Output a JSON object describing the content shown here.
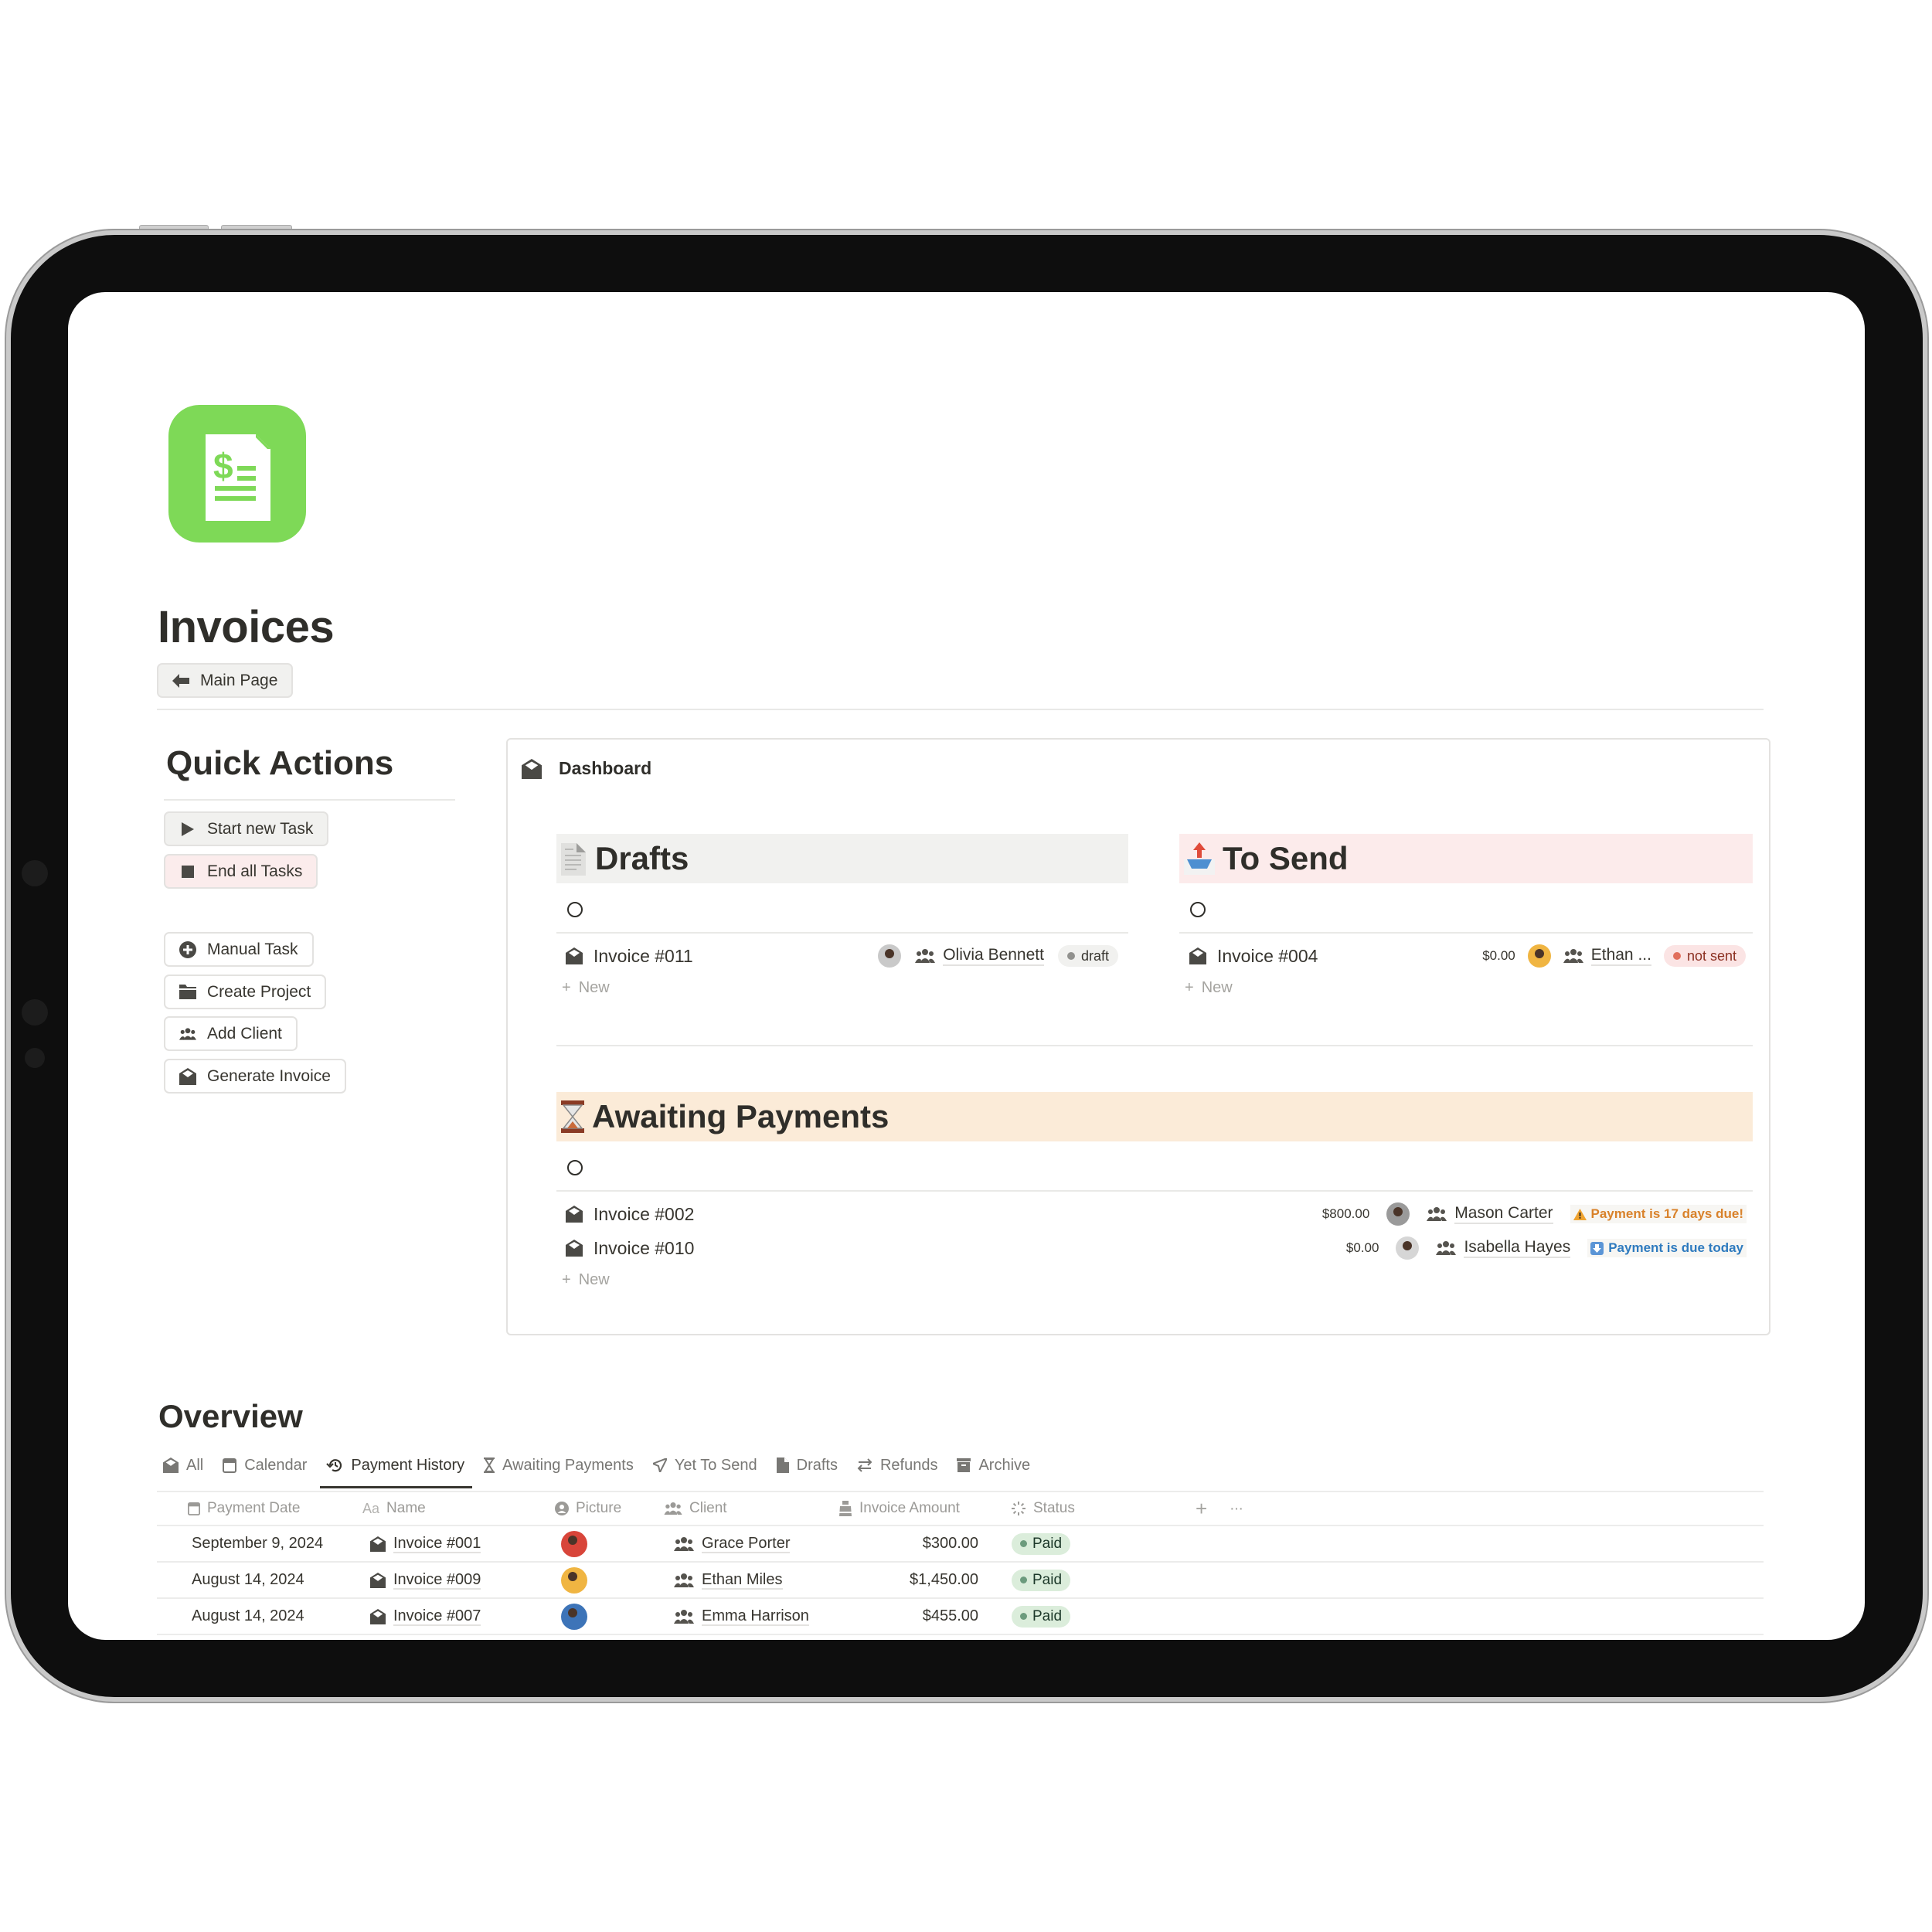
{
  "page": {
    "title": "Invoices",
    "back_button": "Main Page",
    "icon": "invoice-dollar-icon",
    "accent_color": "#7ed957"
  },
  "quick_actions": {
    "heading": "Quick Actions",
    "buttons": [
      {
        "label": "Start new Task",
        "icon": "play-icon"
      },
      {
        "label": "End all Tasks",
        "icon": "stop-icon"
      },
      {
        "label": "Manual Task",
        "icon": "plus-circle-icon"
      },
      {
        "label": "Create Project",
        "icon": "folder-icon"
      },
      {
        "label": "Add Client",
        "icon": "people-icon"
      },
      {
        "label": "Generate Invoice",
        "icon": "envelope-open-icon"
      }
    ]
  },
  "dashboard": {
    "title": "Dashboard",
    "new_label": "New",
    "drafts": {
      "heading": "Drafts",
      "items": [
        {
          "name": "Invoice #011",
          "client": "Olivia Bennett",
          "status": "draft"
        }
      ]
    },
    "to_send": {
      "heading": "To Send",
      "items": [
        {
          "name": "Invoice #004",
          "amount": "$0.00",
          "client": "Ethan ...",
          "status": "not sent"
        }
      ]
    },
    "awaiting": {
      "heading": "Awaiting Payments",
      "items": [
        {
          "name": "Invoice #002",
          "amount": "$800.00",
          "client": "Mason Carter",
          "notice": "Payment is 17 days due!",
          "notice_color": "#d9822b"
        },
        {
          "name": "Invoice #010",
          "amount": "$0.00",
          "client": "Isabella Hayes",
          "notice": "Payment is due today",
          "notice_color": "#2f7bbf"
        }
      ]
    }
  },
  "overview": {
    "heading": "Overview",
    "tabs": [
      {
        "label": "All",
        "icon": "envelope-open-icon"
      },
      {
        "label": "Calendar",
        "icon": "calendar-icon"
      },
      {
        "label": "Payment History",
        "icon": "history-icon",
        "active": true
      },
      {
        "label": "Awaiting Payments",
        "icon": "hourglass-icon"
      },
      {
        "label": "Yet To Send",
        "icon": "send-icon"
      },
      {
        "label": "Drafts",
        "icon": "document-icon"
      },
      {
        "label": "Refunds",
        "icon": "arrows-swap-icon"
      },
      {
        "label": "Archive",
        "icon": "archive-icon"
      }
    ],
    "columns": [
      "Payment Date",
      "Name",
      "Picture",
      "Client",
      "Invoice Amount",
      "Status"
    ],
    "rows": [
      {
        "date": "September 9, 2024",
        "name": "Invoice #001",
        "client": "Grace Porter",
        "amount": "$300.00",
        "status": "Paid"
      },
      {
        "date": "August 14, 2024",
        "name": "Invoice #009",
        "client": "Ethan Miles",
        "amount": "$1,450.00",
        "status": "Paid"
      },
      {
        "date": "August 14, 2024",
        "name": "Invoice #007",
        "client": "Emma Harrison",
        "amount": "$455.00",
        "status": "Paid"
      }
    ]
  }
}
